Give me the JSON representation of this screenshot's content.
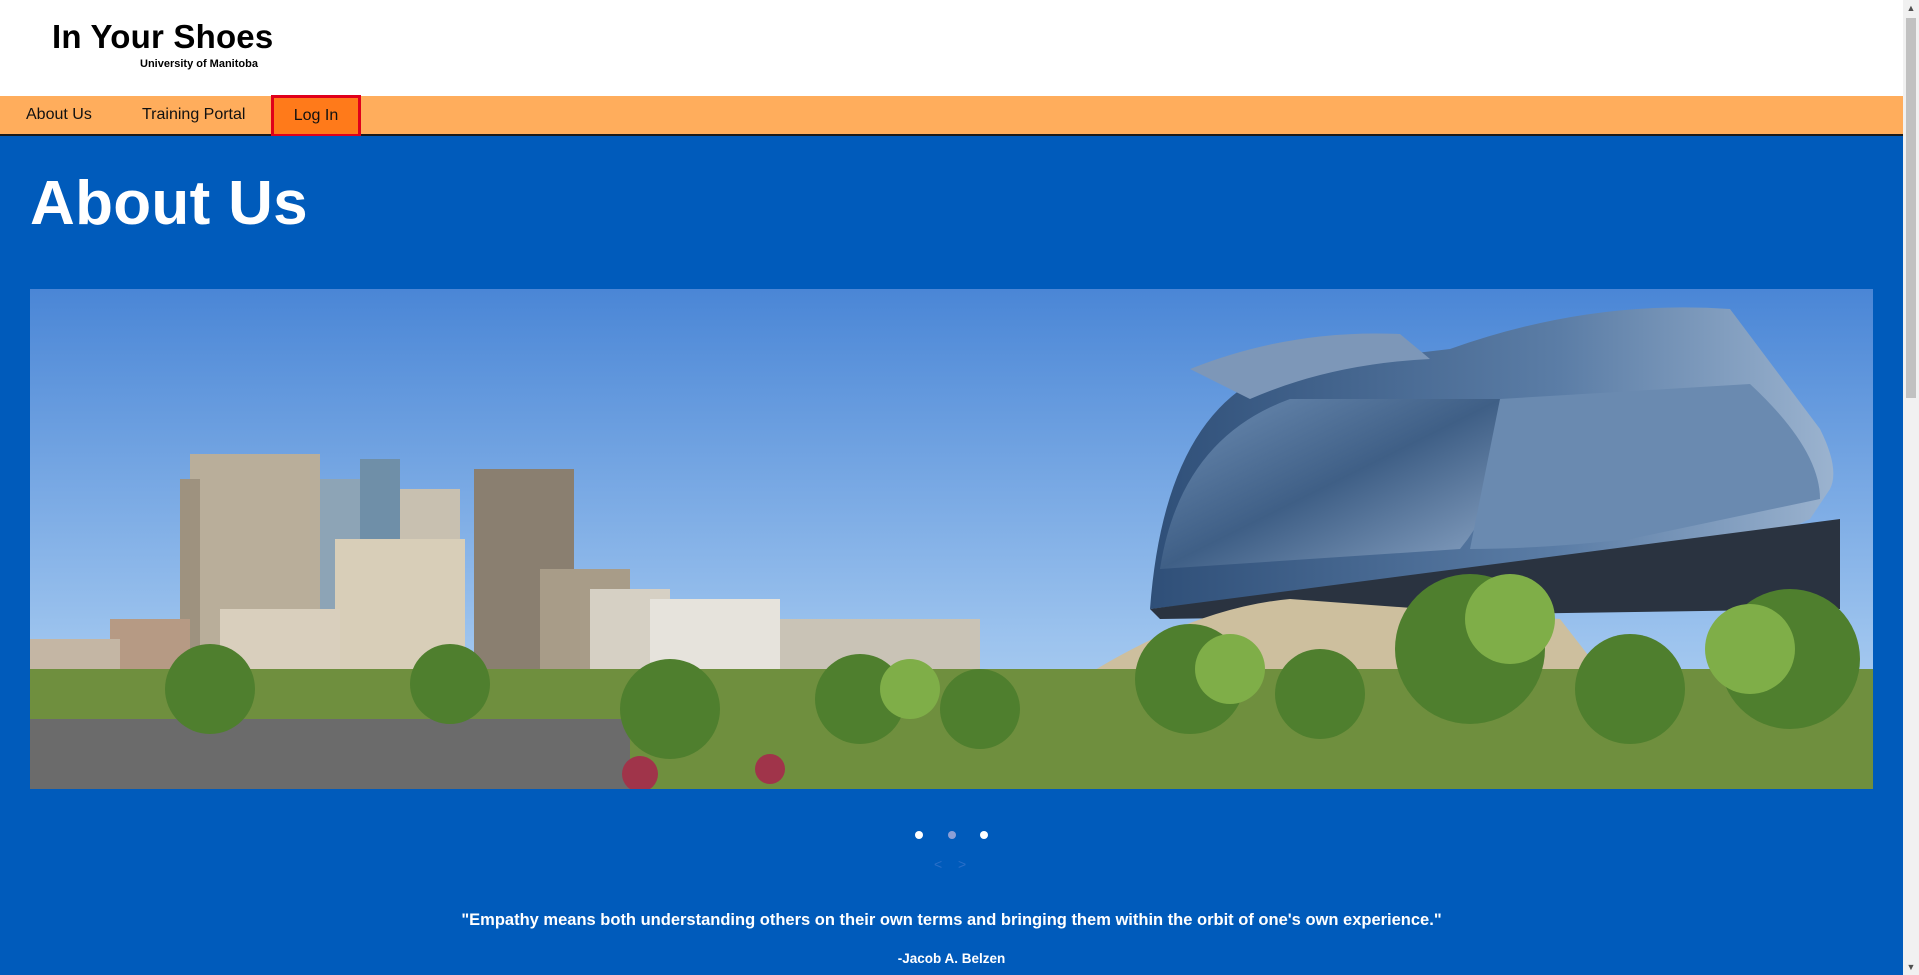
{
  "header": {
    "title": "In Your Shoes",
    "subtitle": "University of Manitoba"
  },
  "nav": {
    "items": [
      {
        "label": "About Us"
      },
      {
        "label": "Training Portal"
      },
      {
        "label": "Log In"
      }
    ],
    "highlighted_item": "Log In",
    "bar_color": "#ffad5c",
    "active_color": "#ff7a1a",
    "highlight_border_color": "#e0001a"
  },
  "main": {
    "title": "About Us",
    "background_color": "#005bbb",
    "carousel": {
      "image_description_icon": "city-skyline-image",
      "slide_count": 3,
      "active_slide": 2,
      "prev_label": "<",
      "next_label": ">"
    },
    "quote": {
      "text": "\"Empathy means both understanding others on their own terms and bringing them within the orbit of one's own experience.\"",
      "author": "-Jacob A. Belzen"
    }
  }
}
